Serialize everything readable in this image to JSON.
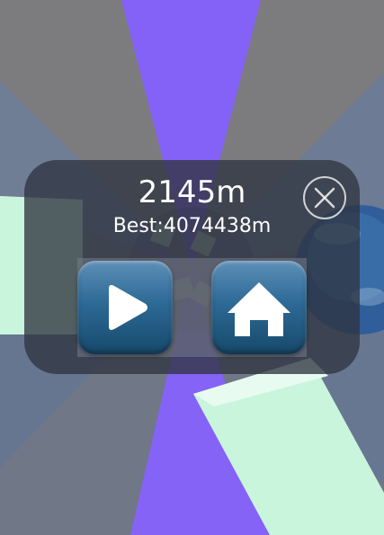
{
  "hud": {
    "distance": "2145m",
    "best": "Best:4074438m"
  },
  "buttons": {
    "close_icon": "close-icon",
    "play_icon": "play-icon",
    "home_icon": "home-icon"
  },
  "colors": {
    "purple_beam": "#8462f7",
    "grey_beam": "#7d7d7d",
    "slate_beam": "#6d7c97",
    "mint_block": "#c9f5dd",
    "button_blue": "#2d6a96",
    "panel": "#303440"
  }
}
